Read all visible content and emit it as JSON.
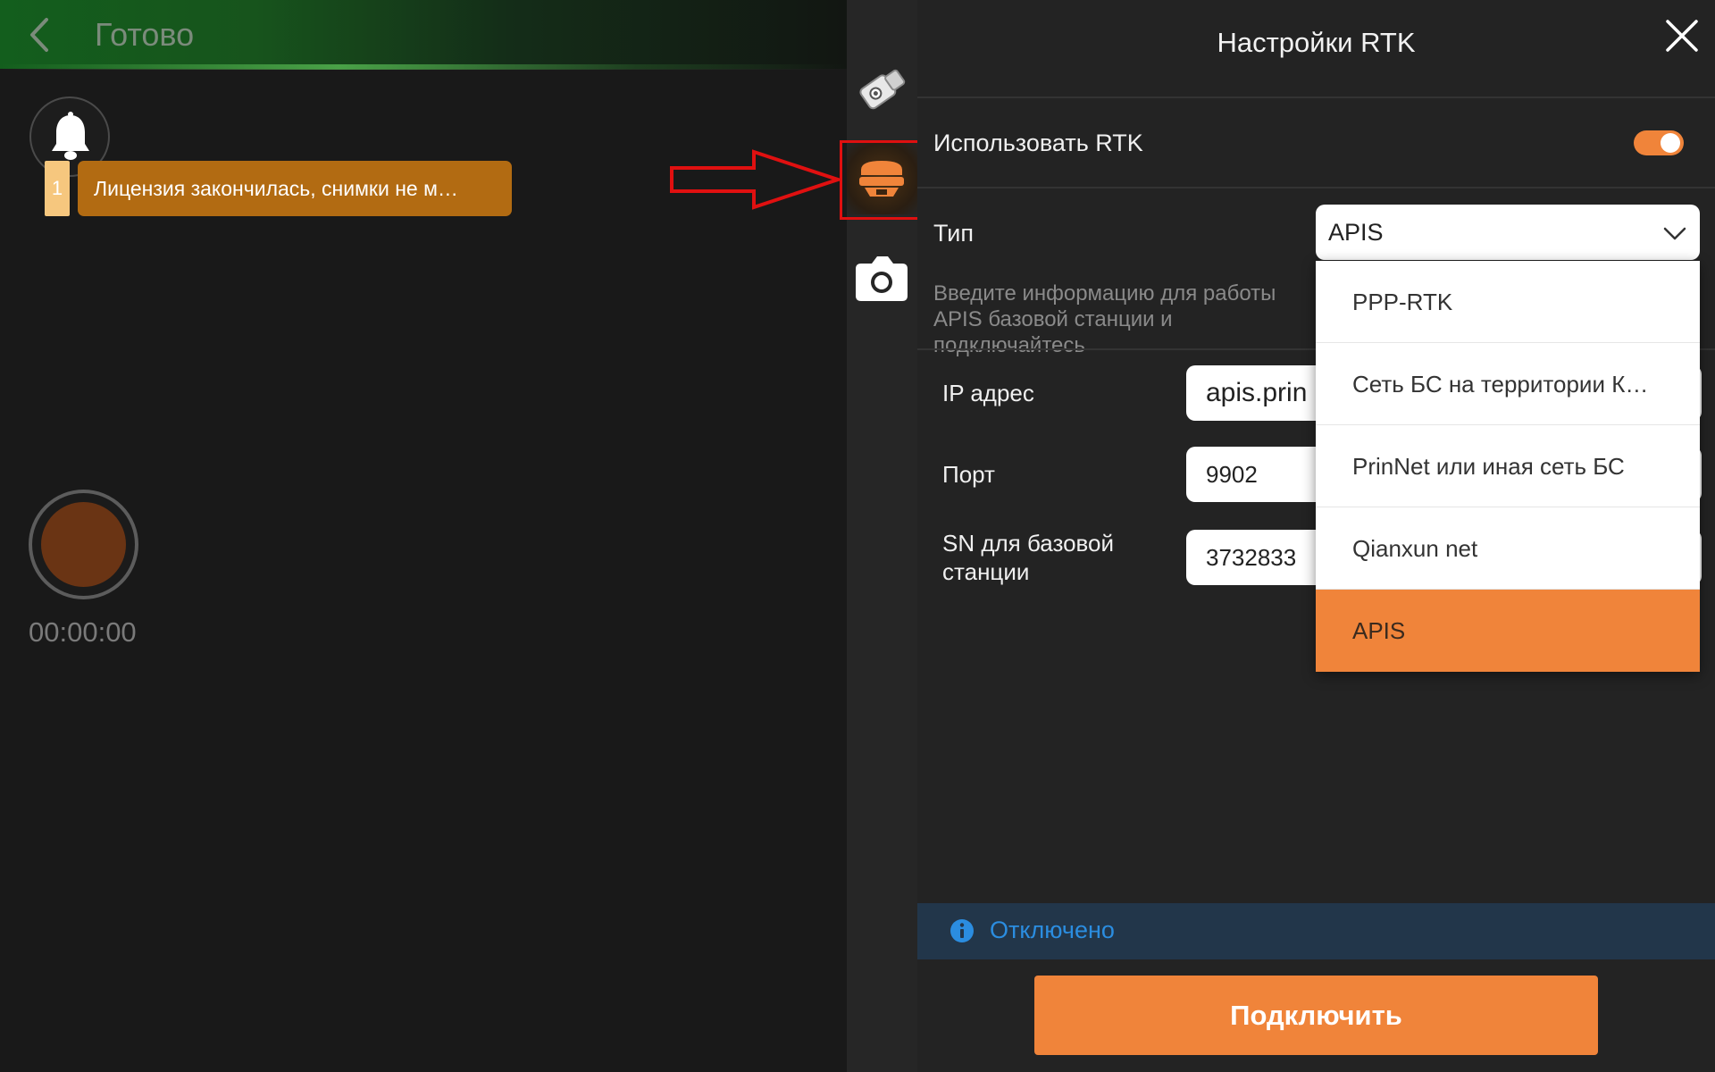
{
  "header": {
    "status_title": "Готово",
    "back_icon": "chevron-left-icon"
  },
  "notifications": {
    "count": "1",
    "message": "Лицензия закончилась, снимки не м…",
    "bell_icon": "bell-icon"
  },
  "recording": {
    "timer": "00:00:00"
  },
  "toolbar": {
    "items": [
      {
        "icon": "gimbal-camera-icon"
      },
      {
        "icon": "rtk-receiver-icon",
        "active": true
      },
      {
        "icon": "camera-icon"
      }
    ]
  },
  "rtk_panel": {
    "title": "Настройки RTK",
    "use_rtk_label": "Использовать RTK",
    "use_rtk_enabled": true,
    "type_label": "Тип",
    "type_value": "APIS",
    "hint": "Введите информацию для работы APIS базовой станции и подключайтесь",
    "fields": {
      "ip_label": "IP адрес",
      "ip_value": "apis.prin",
      "port_label": "Порт",
      "port_value": "9902",
      "sn_label": "SN для базовой станции",
      "sn_value": "3732833"
    },
    "type_options": [
      "PPP-RTK",
      "Сеть БС на территории К…",
      "PrinNet или иная сеть БС",
      "Qianxun net",
      "APIS"
    ],
    "selected_option": "APIS",
    "status_text": "Отключено",
    "connect_label": "Подключить"
  },
  "colors": {
    "accent": "#f0843a",
    "annotation_red": "#e01010",
    "status_blue": "#2b8de0",
    "notification_bg": "#b26b12"
  }
}
